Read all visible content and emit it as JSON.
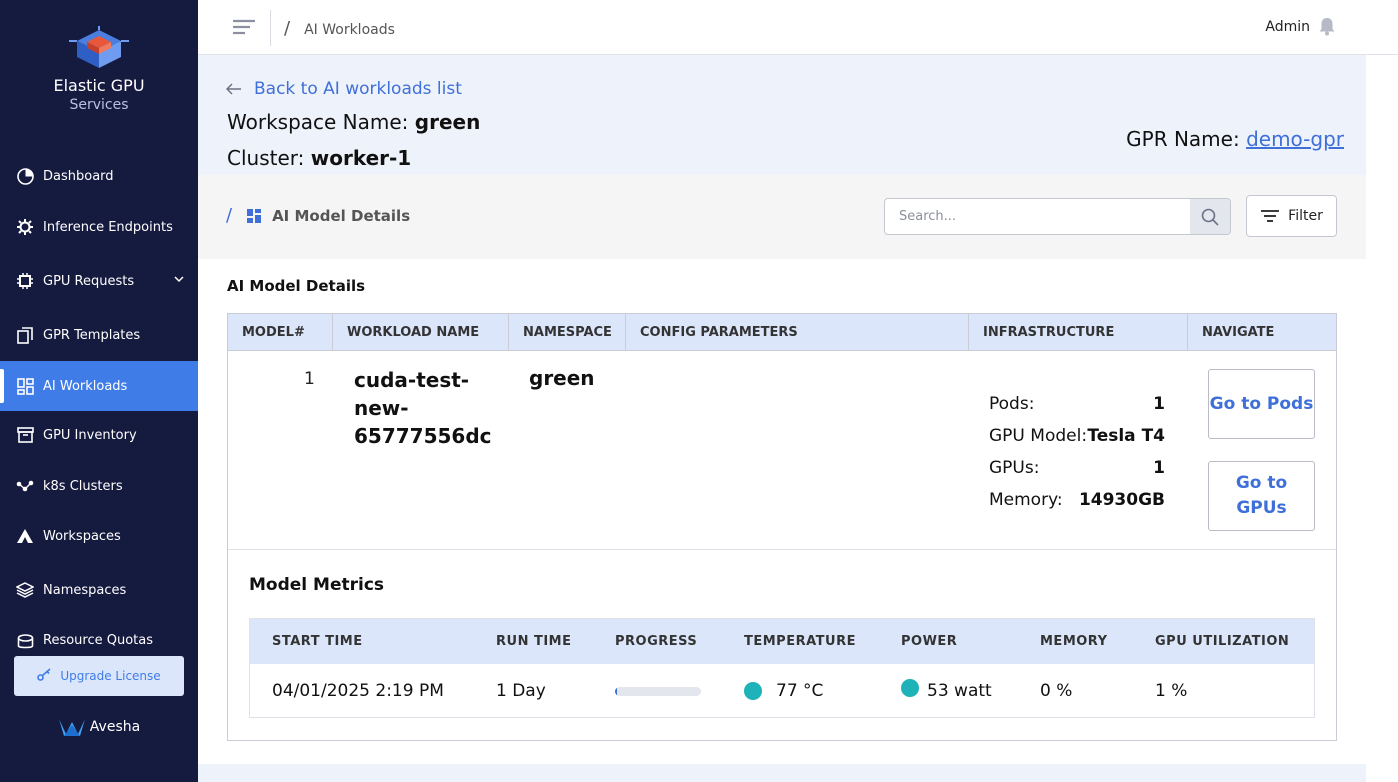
{
  "brand": {
    "title": "Elastic GPU",
    "subtitle": "Services",
    "footer": "Avesha"
  },
  "sidebar": {
    "items": [
      {
        "label": "Dashboard",
        "icon": "pie-chart-icon"
      },
      {
        "label": "Inference Endpoints",
        "icon": "chip-gear-icon"
      },
      {
        "label": "GPU Requests",
        "icon": "chip-icon"
      },
      {
        "label": "GPR Templates",
        "icon": "copy-icon"
      },
      {
        "label": "AI Workloads",
        "icon": "dashboard-grid-icon"
      },
      {
        "label": "GPU Inventory",
        "icon": "archive-box-icon"
      },
      {
        "label": "k8s Clusters",
        "icon": "network-nodes-icon"
      },
      {
        "label": "Workspaces",
        "icon": "tent-icon"
      },
      {
        "label": "Namespaces",
        "icon": "layers-icon"
      },
      {
        "label": "Resource Quotas",
        "icon": "quota-icon"
      }
    ],
    "active_index": 4,
    "upgrade_label": "Upgrade License"
  },
  "topbar": {
    "breadcrumb": "AI Workloads",
    "user": "Admin"
  },
  "header": {
    "back_label": "Back to AI workloads list",
    "workspace_label": "Workspace Name:",
    "workspace_value": "green",
    "cluster_label": "Cluster:",
    "cluster_value": "worker-1",
    "gpr_label": "GPR Name:",
    "gpr_value": "demo-gpr"
  },
  "subbar": {
    "breadcrumb": "AI Model Details",
    "search_placeholder": "Search...",
    "filter_label": "Filter"
  },
  "details": {
    "title": "AI Model Details",
    "columns": [
      "MODEL#",
      "WORKLOAD NAME",
      "NAMESPACE",
      "CONFIG PARAMETERS",
      "INFRASTRUCTURE",
      "NAVIGATE"
    ],
    "row": {
      "model_num": "1",
      "workload_name": "cuda-test-new-65777556dc",
      "namespace": "green",
      "infra": [
        {
          "label": "Pods:",
          "value": "1"
        },
        {
          "label": "GPU Model:",
          "value": "Tesla T4"
        },
        {
          "label": "GPUs:",
          "value": "1"
        },
        {
          "label": "Memory:",
          "value": "14930GB"
        }
      ],
      "go_pods": "Go to Pods",
      "go_gpus": "Go to GPUs"
    }
  },
  "metrics": {
    "title": "Model Metrics",
    "columns": [
      "START TIME",
      "RUN TIME",
      "PROGRESS",
      "TEMPERATURE",
      "POWER",
      "MEMORY",
      "GPU UTILIZATION"
    ],
    "row": {
      "start_time": "04/01/2025 2:19 PM",
      "run_time": "1 Day",
      "progress_percent": 2,
      "temperature": "77 °C",
      "power": "53 watt",
      "memory": "0 %",
      "gpu_utilization": "1 %"
    },
    "status_color": "#1fb2b8"
  },
  "colors": {
    "sidebar_bg": "#151a3f",
    "accent": "#3f7ce8",
    "link": "#3f6fd8",
    "header_bg": "#dbe6fb"
  }
}
